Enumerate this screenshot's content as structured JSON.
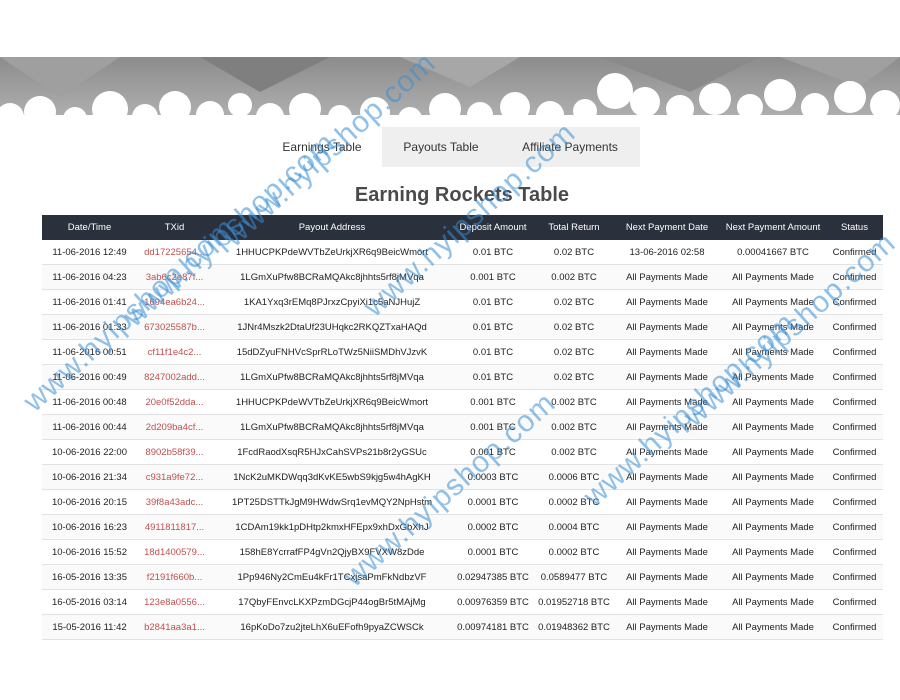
{
  "tabs": [
    {
      "label": "Earnings Table"
    },
    {
      "label": "Payouts Table"
    },
    {
      "label": "Affiliate Payments"
    }
  ],
  "page_title": "Earning Rockets Table",
  "table": {
    "headers": [
      "Date/Time",
      "TXid",
      "Payout Address",
      "Deposit Amount",
      "Total Return",
      "Next Payment Date",
      "Next Payment Amount",
      "Status"
    ],
    "rows": [
      [
        "11-06-2016 12:49",
        "dd17225654...",
        "1HHUCPKPdeWVTbZeUrkjXR6q9BeicWmort",
        "0.01 BTC",
        "0.02 BTC",
        "13-06-2016 02:58",
        "0.00041667 BTC",
        "Confirmed"
      ],
      [
        "11-06-2016 04:23",
        "3ab6c2e87f...",
        "1LGmXuPfw8BCRaMQAkc8jhhts5rf8jMVqa",
        "0.001 BTC",
        "0.002 BTC",
        "All Payments Made",
        "All Payments Made",
        "Confirmed"
      ],
      [
        "11-06-2016 01:41",
        "1694ea6b24...",
        "1KA1Yxq3rEMq8PJrxzCpyiXi1c5aNJHujZ",
        "0.01 BTC",
        "0.02 BTC",
        "All Payments Made",
        "All Payments Made",
        "Confirmed"
      ],
      [
        "11-06-2016 01:33",
        "673025587b...",
        "1JNr4Mszk2DtaUf23UHqkc2RKQZTxaHAQd",
        "0.01 BTC",
        "0.02 BTC",
        "All Payments Made",
        "All Payments Made",
        "Confirmed"
      ],
      [
        "11-06-2016 00:51",
        "cf11f1e4c2...",
        "15dDZyuFNHVcSprRLoTWz5NiiSMDhVJzvK",
        "0.01 BTC",
        "0.02 BTC",
        "All Payments Made",
        "All Payments Made",
        "Confirmed"
      ],
      [
        "11-06-2016 00:49",
        "8247002add...",
        "1LGmXuPfw8BCRaMQAkc8jhhts5rf8jMVqa",
        "0.01 BTC",
        "0.02 BTC",
        "All Payments Made",
        "All Payments Made",
        "Confirmed"
      ],
      [
        "11-06-2016 00:48",
        "20e0f52dda...",
        "1HHUCPKPdeWVTbZeUrkjXR6q9BeicWmort",
        "0.001 BTC",
        "0.002 BTC",
        "All Payments Made",
        "All Payments Made",
        "Confirmed"
      ],
      [
        "11-06-2016 00:44",
        "2d209ba4cf...",
        "1LGmXuPfw8BCRaMQAkc8jhhts5rf8jMVqa",
        "0.001 BTC",
        "0.002 BTC",
        "All Payments Made",
        "All Payments Made",
        "Confirmed"
      ],
      [
        "10-06-2016 22:00",
        "8902b58f39...",
        "1FcdRaodXsqR5HJxCahSVPs21b8r2yGSUc",
        "0.001 BTC",
        "0.002 BTC",
        "All Payments Made",
        "All Payments Made",
        "Confirmed"
      ],
      [
        "10-06-2016 21:34",
        "c931a9fe72...",
        "1NcK2uMKDWqq3dKvKE5wbS9kjg5w4hAgKH",
        "0.0003 BTC",
        "0.0006 BTC",
        "All Payments Made",
        "All Payments Made",
        "Confirmed"
      ],
      [
        "10-06-2016 20:15",
        "39f8a43adc...",
        "1PT25DSTTkJgM9HWdwSrq1evMQY2NpHstm",
        "0.0001 BTC",
        "0.0002 BTC",
        "All Payments Made",
        "All Payments Made",
        "Confirmed"
      ],
      [
        "10-06-2016 16:23",
        "4911811817...",
        "1CDAm19kk1pDHtp2kmxHFEpx9xhDxGbXhJ",
        "0.0002 BTC",
        "0.0004 BTC",
        "All Payments Made",
        "All Payments Made",
        "Confirmed"
      ],
      [
        "10-06-2016 15:52",
        "18d1400579...",
        "158hE8YcrrafFP4gVn2QjyBX9FVXW8zDde",
        "0.0001 BTC",
        "0.0002 BTC",
        "All Payments Made",
        "All Payments Made",
        "Confirmed"
      ],
      [
        "16-05-2016 13:35",
        "f2191f660b...",
        "1Pp946Ny2CmEu4kFr1TCxjsaPmFkNdbzVF",
        "0.02947385 BTC",
        "0.0589477 BTC",
        "All Payments Made",
        "All Payments Made",
        "Confirmed"
      ],
      [
        "16-05-2016 03:14",
        "123e8a0556...",
        "17QbyFEnvcLKXPzmDGcjP44ogBr5tMAjMg",
        "0.00976359 BTC",
        "0.01952718 BTC",
        "All Payments Made",
        "All Payments Made",
        "Confirmed"
      ],
      [
        "15-05-2016 11:42",
        "b2841aa3a1...",
        "16pKoDo7zu2jteLhX6uEFofh9pyaZCWSCk",
        "0.00974181 BTC",
        "0.01948362 BTC",
        "All Payments Made",
        "All Payments Made",
        "Confirmed"
      ]
    ]
  },
  "watermark": {
    "text": "www.hyipshop.com",
    "color": "#3a8fd6"
  },
  "colors": {
    "header_bg": "#2b313c",
    "txid_link": "#c0504d",
    "tab_inactive_bg": "#efefef",
    "cloud_gray": "#9a9a9a"
  }
}
